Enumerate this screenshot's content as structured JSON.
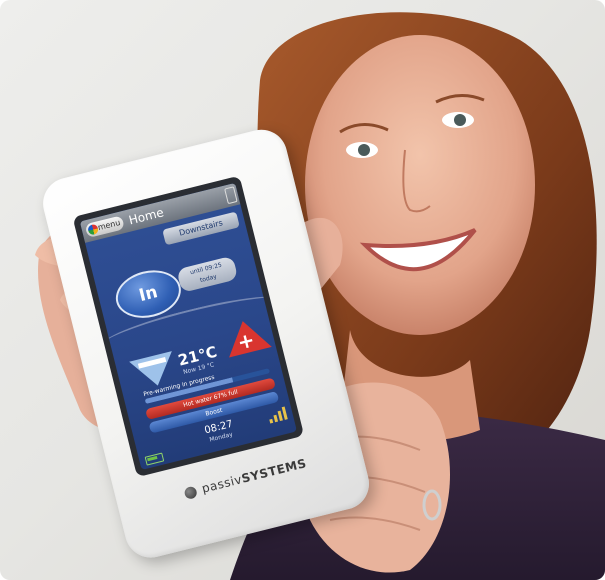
{
  "device": {
    "menu_label": "menu",
    "screen_title": "Home",
    "zone_button": "Downstairs",
    "status_button": "In",
    "until_line1": "until 09:25",
    "until_line2": "today",
    "temperature": "21°C",
    "setpoint": "Now 19 °C",
    "prewarm_label": "Pre-warming in progress",
    "prewarm_progress": 0.7,
    "hotwater_label": "Hot water 67% full",
    "boost_label": "Boost",
    "time": "08:27",
    "day": "Monday",
    "brand_light": "passiv",
    "brand_bold": "SYSTEMS"
  },
  "icons": [
    "menu-logo-icon",
    "lock-icon",
    "minus-icon",
    "plus-icon",
    "signal-icon",
    "battery-icon",
    "brand-logo-icon"
  ],
  "colors": {
    "screen_blue": "#2f4f95",
    "plus_red": "#d9352f",
    "minus_blue": "#9ec2ea",
    "device_white": "#f3f3f1"
  }
}
